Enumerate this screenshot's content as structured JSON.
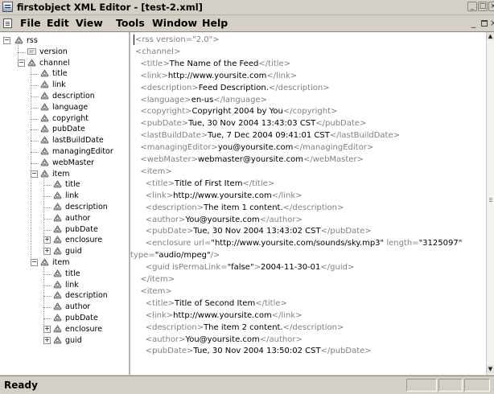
{
  "window": {
    "title": "firstobject XML Editor - [test-2.xml]"
  },
  "menu": [
    "File",
    "Edit",
    "View",
    "Tools",
    "Window",
    "Help"
  ],
  "tree": [
    {
      "label": "rss",
      "icon": "element-icon",
      "selected": true
    },
    {
      "label": "version",
      "icon": "attribute-icon"
    },
    {
      "label": "channel",
      "icon": "element-icon",
      "expanded": true
    },
    {
      "label": "title",
      "icon": "element-icon"
    },
    {
      "label": "link",
      "icon": "element-icon"
    },
    {
      "label": "description",
      "icon": "element-icon"
    },
    {
      "label": "language",
      "icon": "element-icon"
    },
    {
      "label": "copyright",
      "icon": "element-icon"
    },
    {
      "label": "pubDate",
      "icon": "element-icon"
    },
    {
      "label": "lastBuildDate",
      "icon": "element-icon"
    },
    {
      "label": "managingEditor",
      "icon": "element-icon"
    },
    {
      "label": "webMaster",
      "icon": "element-icon"
    },
    {
      "label": "item",
      "icon": "element-icon",
      "expanded": true
    },
    {
      "label": "title",
      "icon": "element-icon"
    },
    {
      "label": "link",
      "icon": "element-icon"
    },
    {
      "label": "description",
      "icon": "element-icon"
    },
    {
      "label": "author",
      "icon": "element-icon"
    },
    {
      "label": "pubDate",
      "icon": "element-icon"
    },
    {
      "label": "enclosure",
      "icon": "element-icon",
      "expanded": false
    },
    {
      "label": "guid",
      "icon": "element-icon",
      "expanded": false
    },
    {
      "label": "item",
      "icon": "element-icon",
      "expanded": true
    },
    {
      "label": "title",
      "icon": "element-icon"
    },
    {
      "label": "link",
      "icon": "element-icon"
    },
    {
      "label": "description",
      "icon": "element-icon"
    },
    {
      "label": "author",
      "icon": "element-icon"
    },
    {
      "label": "pubDate",
      "icon": "element-icon"
    },
    {
      "label": "enclosure",
      "icon": "element-icon",
      "expanded": false
    },
    {
      "label": "guid",
      "icon": "element-icon",
      "expanded": false
    }
  ],
  "code": [
    [
      [
        "t",
        "<rss version=\"2.0\">"
      ]
    ],
    [
      [
        "t",
        "<channel>"
      ]
    ],
    [
      [
        "t",
        "  <title>"
      ],
      [
        "v",
        "The Name of the Feed"
      ],
      [
        "t",
        "</title>"
      ]
    ],
    [
      [
        "t",
        "  <link>"
      ],
      [
        "v",
        "http://www.yoursite.com"
      ],
      [
        "t",
        "</link>"
      ]
    ],
    [
      [
        "t",
        "  <description>"
      ],
      [
        "v",
        "Feed Description."
      ],
      [
        "t",
        "</description>"
      ]
    ],
    [
      [
        "t",
        "  <language>"
      ],
      [
        "v",
        "en-us"
      ],
      [
        "t",
        "</language>"
      ]
    ],
    [
      [
        "t",
        "  <copyright>"
      ],
      [
        "v",
        "Copyright 2004 by You"
      ],
      [
        "t",
        "</copyright>"
      ]
    ],
    [
      [
        "t",
        "  <pubDate>"
      ],
      [
        "v",
        "Tue, 30 Nov 2004 13:43:03 CST"
      ],
      [
        "t",
        "</pubDate>"
      ]
    ],
    [
      [
        "t",
        "  <lastBuildDate>"
      ],
      [
        "v",
        "Tue, 7 Dec 2004 09:41:01 CST"
      ],
      [
        "t",
        "</lastBuildDate>"
      ]
    ],
    [
      [
        "t",
        "  <managingEditor>"
      ],
      [
        "v",
        "you@yoursite.com"
      ],
      [
        "t",
        "</managingEditor>"
      ]
    ],
    [
      [
        "t",
        "  <webMaster>"
      ],
      [
        "v",
        "webmaster@yoursite.com"
      ],
      [
        "t",
        "</webMaster>"
      ]
    ],
    [
      [
        "t",
        "  <item>"
      ]
    ],
    [
      [
        "t",
        "    <title>"
      ],
      [
        "v",
        "Title of First Item"
      ],
      [
        "t",
        "</title>"
      ]
    ],
    [
      [
        "t",
        "    <link>"
      ],
      [
        "v",
        "http://www.yoursite.com"
      ],
      [
        "t",
        "</link>"
      ]
    ],
    [
      [
        "t",
        "    <description>"
      ],
      [
        "v",
        "The item 1 content."
      ],
      [
        "t",
        "</description>"
      ]
    ],
    [
      [
        "t",
        "    <author>"
      ],
      [
        "v",
        "You@yoursite.com"
      ],
      [
        "t",
        "</author>"
      ]
    ],
    [
      [
        "t",
        "    <pubDate>"
      ],
      [
        "v",
        "Tue, 30 Nov 2004 13:43:02 CST"
      ],
      [
        "t",
        "</pubDate>"
      ]
    ],
    [
      [
        "t",
        "    <enclosure url="
      ],
      [
        "v",
        "\"http://www.yoursite.com/sounds/sky.mp3\""
      ],
      [
        "t",
        " length="
      ],
      [
        "v",
        "\"3125097\""
      ]
    ],
    [
      [
        "t",
        "type="
      ],
      [
        "v",
        "\"audio/mpeg\""
      ],
      [
        "t",
        "/>"
      ]
    ],
    [
      [
        "t",
        "    <guid isPermaLink="
      ],
      [
        "v",
        "\"false\""
      ],
      [
        "t",
        ">"
      ],
      [
        "v",
        "2004-11-30-01"
      ],
      [
        "t",
        "</guid>"
      ]
    ],
    [
      [
        "t",
        "  </item>"
      ]
    ],
    [
      [
        "t",
        "  <item>"
      ]
    ],
    [
      [
        "t",
        "    <title>"
      ],
      [
        "v",
        "Title of Second Item"
      ],
      [
        "t",
        "</title>"
      ]
    ],
    [
      [
        "t",
        "    <link>"
      ],
      [
        "v",
        "http://www.yoursite.com"
      ],
      [
        "t",
        "</link>"
      ]
    ],
    [
      [
        "t",
        "    <description>"
      ],
      [
        "v",
        "The item 2 content."
      ],
      [
        "t",
        "</description>"
      ]
    ],
    [
      [
        "t",
        "    <author>"
      ],
      [
        "v",
        "You@yoursite.com"
      ],
      [
        "t",
        "</author>"
      ]
    ],
    [
      [
        "t",
        "    <pubDate>"
      ],
      [
        "v",
        "Tue, 30 Nov 2004 13:50:02 CST"
      ],
      [
        "t",
        "</pubDate>"
      ]
    ]
  ],
  "status": {
    "text": "Ready"
  },
  "colors": {
    "tag": "#808080",
    "value": "#000000",
    "chrome": "#d4d0c8"
  }
}
